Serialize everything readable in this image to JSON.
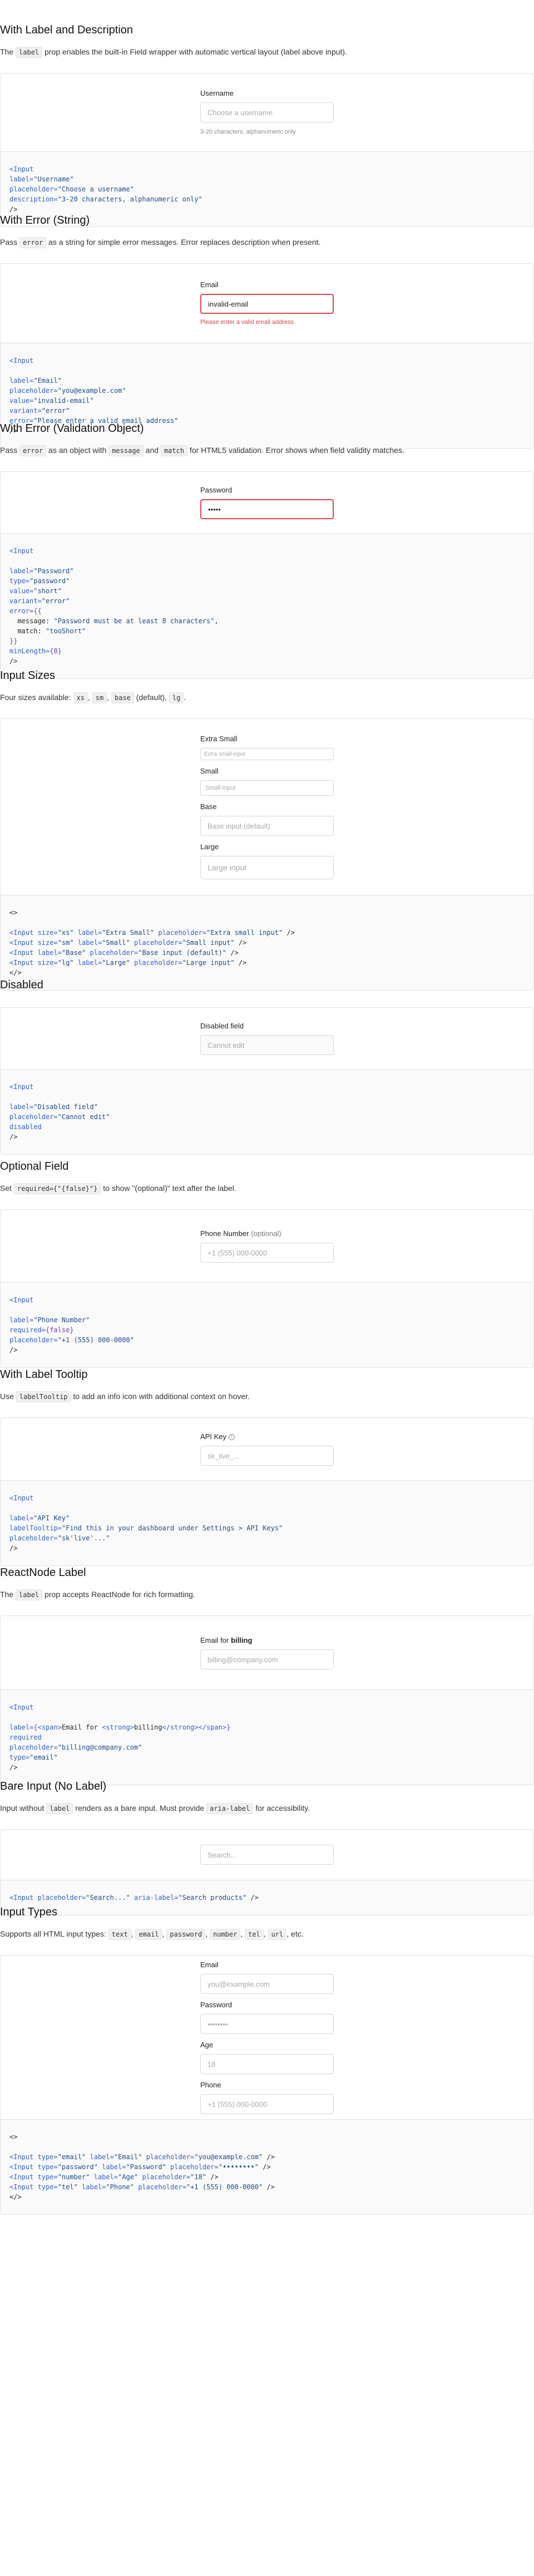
{
  "sections": [
    {
      "id": "label_desc",
      "title": "With Label and Description",
      "desc": [
        {
          "t": "The "
        },
        {
          "c": "label"
        },
        {
          "t": " prop enables the built-in Field wrapper with automatic vertical layout (label above input)."
        }
      ],
      "fields": [
        {
          "label": "Username",
          "placeholder": "Choose a username",
          "value": "",
          "hint": "3-20 characters, alphanumeric only"
        }
      ],
      "code": [
        [
          [
            "k",
            "<Input"
          ]
        ],
        [
          [
            "a",
            "label="
          ],
          [
            "s",
            "\"Username\""
          ]
        ],
        [
          [
            "a",
            "placeholder="
          ],
          [
            "s",
            "\"Choose a username\""
          ]
        ],
        [
          [
            "a",
            "description="
          ],
          [
            "s",
            "\"3-20 characters, alphanumeric only\""
          ]
        ],
        [
          [
            "p",
            "/>"
          ]
        ]
      ]
    },
    {
      "id": "error_string",
      "title": "With Error (String)",
      "desc": [
        {
          "t": "Pass "
        },
        {
          "c": "error"
        },
        {
          "t": " as a string for simple error messages. Error replaces description when present."
        }
      ],
      "fields": [
        {
          "label": "Email",
          "placeholder": "you@example.com",
          "value": "invalid-email",
          "error": "Please enter a valid email address"
        }
      ],
      "code": [
        [
          [
            "k",
            "<Input"
          ]
        ],
        [],
        [
          [
            "a",
            "label="
          ],
          [
            "s",
            "\"Email\""
          ]
        ],
        [
          [
            "a",
            "placeholder="
          ],
          [
            "s",
            "\"you@example.com\""
          ]
        ],
        [
          [
            "a",
            "value="
          ],
          [
            "s",
            "\"invalid-email\""
          ]
        ],
        [
          [
            "a",
            "variant="
          ],
          [
            "s",
            "\"error\""
          ]
        ],
        [
          [
            "a",
            "error="
          ],
          [
            "s",
            "\"Please enter a valid email address\""
          ]
        ],
        [
          [
            "p",
            "/>"
          ]
        ]
      ]
    },
    {
      "id": "error_object",
      "title": "With Error (Validation Object)",
      "desc": [
        {
          "t": "Pass "
        },
        {
          "c": "error"
        },
        {
          "t": " as an object with "
        },
        {
          "c": "message"
        },
        {
          "t": " and "
        },
        {
          "c": "match"
        },
        {
          "t": " for HTML5 validation. Error shows when field validity matches."
        }
      ],
      "fields": [
        {
          "label": "Password",
          "placeholder": "",
          "value": "short",
          "password": true,
          "errorBorder": true
        }
      ],
      "code": [
        [
          [
            "k",
            "<Input"
          ]
        ],
        [],
        [
          [
            "a",
            "label="
          ],
          [
            "s",
            "\"Password\""
          ]
        ],
        [
          [
            "a",
            "type="
          ],
          [
            "s",
            "\"password\""
          ]
        ],
        [
          [
            "a",
            "value="
          ],
          [
            "s",
            "\"short\""
          ]
        ],
        [
          [
            "a",
            "variant="
          ],
          [
            "s",
            "\"error\""
          ]
        ],
        [
          [
            "a",
            "error="
          ],
          [
            "e",
            "{{"
          ]
        ],
        [
          [
            "p",
            "  message: "
          ],
          [
            "s",
            "\"Password must be at least 8 characters\""
          ],
          [
            "p",
            ","
          ]
        ],
        [
          [
            "p",
            "  match: "
          ],
          [
            "s",
            "\"tooShort\""
          ]
        ],
        [
          [
            "e",
            "}}"
          ]
        ],
        [
          [
            "a",
            "minLength="
          ],
          [
            "e",
            "{8}"
          ]
        ],
        [
          [
            "p",
            "/>"
          ]
        ]
      ]
    },
    {
      "id": "sizes",
      "title": "Input Sizes",
      "desc": [
        {
          "t": "Four sizes available: "
        },
        {
          "c": "xs"
        },
        {
          "t": ", "
        },
        {
          "c": "sm"
        },
        {
          "t": ", "
        },
        {
          "c": "base"
        },
        {
          "t": " (default), "
        },
        {
          "c": "lg"
        },
        {
          "t": "."
        }
      ],
      "fields": [
        {
          "label": "Extra Small",
          "placeholder": "Extra small input",
          "value": "",
          "size": "xs"
        },
        {
          "label": "Small",
          "placeholder": "Small input",
          "value": "",
          "size": "sm"
        },
        {
          "label": "Base",
          "placeholder": "Base input (default)",
          "value": ""
        },
        {
          "label": "Large",
          "placeholder": "Large input",
          "value": "",
          "size": "lg"
        }
      ],
      "code": [
        [
          [
            "p",
            "<>"
          ]
        ],
        [],
        [
          [
            "k",
            "<Input "
          ],
          [
            "a",
            "size="
          ],
          [
            "s",
            "\"xs\" "
          ],
          [
            "a",
            "label="
          ],
          [
            "s",
            "\"Extra Small\" "
          ],
          [
            "a",
            "placeholder="
          ],
          [
            "s",
            "\"Extra small input\" "
          ],
          [
            "p",
            "/>"
          ]
        ],
        [
          [
            "k",
            "<Input "
          ],
          [
            "a",
            "size="
          ],
          [
            "s",
            "\"sm\" "
          ],
          [
            "a",
            "label="
          ],
          [
            "s",
            "\"Small\" "
          ],
          [
            "a",
            "placeholder="
          ],
          [
            "s",
            "\"Small input\" "
          ],
          [
            "p",
            "/>"
          ]
        ],
        [
          [
            "k",
            "<Input "
          ],
          [
            "a",
            "label="
          ],
          [
            "s",
            "\"Base\" "
          ],
          [
            "a",
            "placeholder="
          ],
          [
            "s",
            "\"Base input (default)\" "
          ],
          [
            "p",
            "/>"
          ]
        ],
        [
          [
            "k",
            "<Input "
          ],
          [
            "a",
            "size="
          ],
          [
            "s",
            "\"lg\" "
          ],
          [
            "a",
            "label="
          ],
          [
            "s",
            "\"Large\" "
          ],
          [
            "a",
            "placeholder="
          ],
          [
            "s",
            "\"Large input\" "
          ],
          [
            "p",
            "/>"
          ]
        ],
        [
          [
            "p",
            "</>"
          ]
        ]
      ]
    },
    {
      "id": "disabled",
      "title": "Disabled",
      "desc": [],
      "fields": [
        {
          "label": "Disabled field",
          "placeholder": "Cannot edit",
          "value": "",
          "disabled": true
        }
      ],
      "code": [
        [
          [
            "k",
            "<Input"
          ]
        ],
        [],
        [
          [
            "a",
            "label="
          ],
          [
            "s",
            "\"Disabled field\""
          ]
        ],
        [
          [
            "a",
            "placeholder="
          ],
          [
            "s",
            "\"Cannot edit\""
          ]
        ],
        [
          [
            "a",
            "disabled"
          ]
        ],
        [
          [
            "p",
            "/>"
          ]
        ]
      ]
    },
    {
      "id": "optional",
      "title": "Optional Field",
      "desc": [
        {
          "t": "Set "
        },
        {
          "c": "required={\"{false}\"}"
        },
        {
          "t": " to show \"(optional)\" text after the label."
        }
      ],
      "fields": [
        {
          "label": "Phone Number",
          "optional": "(optional)",
          "placeholder": "+1 (555) 000-0000",
          "value": ""
        }
      ],
      "code": [
        [
          [
            "k",
            "<Input"
          ]
        ],
        [],
        [
          [
            "a",
            "label="
          ],
          [
            "s",
            "\"Phone Number\""
          ]
        ],
        [
          [
            "a",
            "required="
          ],
          [
            "e",
            "{false}"
          ]
        ],
        [
          [
            "a",
            "placeholder="
          ],
          [
            "s",
            "\"+1 (555) 000-0000\""
          ]
        ],
        [
          [
            "p",
            "/>"
          ]
        ]
      ]
    },
    {
      "id": "tooltip",
      "title": "With Label Tooltip",
      "desc": [
        {
          "t": "Use "
        },
        {
          "c": "labelTooltip"
        },
        {
          "t": " to add an info icon with additional context on hover."
        }
      ],
      "fields": [
        {
          "label": "API Key",
          "tooltip": "i",
          "placeholder": "sk_live_...",
          "value": ""
        }
      ],
      "code": [
        [
          [
            "k",
            "<Input"
          ]
        ],
        [],
        [
          [
            "a",
            "label="
          ],
          [
            "s",
            "\"API Key\""
          ]
        ],
        [
          [
            "a",
            "labelTooltip="
          ],
          [
            "s",
            "\"Find this in your dashboard under Settings > API Keys\""
          ]
        ],
        [
          [
            "a",
            "placeholder="
          ],
          [
            "s",
            "\"sk'live'...\""
          ]
        ],
        [
          [
            "p",
            "/>"
          ]
        ]
      ]
    },
    {
      "id": "reactnode",
      "title": "ReactNode Label",
      "desc": [
        {
          "t": "The "
        },
        {
          "c": "label"
        },
        {
          "t": " prop accepts ReactNode for rich formatting."
        }
      ],
      "fields": [
        {
          "label": "Email for ",
          "labelBold": "billing",
          "placeholder": "billing@company.com",
          "value": ""
        }
      ],
      "code": [
        [
          [
            "k",
            "<Input"
          ]
        ],
        [],
        [
          [
            "a",
            "label="
          ],
          [
            "e",
            "{"
          ],
          [
            "k",
            "<span>"
          ],
          [
            "p",
            "Email for "
          ],
          [
            "k",
            "<strong>"
          ],
          [
            "p",
            "billing"
          ],
          [
            "k",
            "</strong></span>"
          ],
          [
            "e",
            "}"
          ]
        ],
        [
          [
            "a",
            "required"
          ]
        ],
        [
          [
            "a",
            "placeholder="
          ],
          [
            "s",
            "\"billing@company.com\""
          ]
        ],
        [
          [
            "a",
            "type="
          ],
          [
            "s",
            "\"email\""
          ]
        ],
        [
          [
            "p",
            "/>"
          ]
        ]
      ]
    },
    {
      "id": "bare",
      "title": "Bare Input (No Label)",
      "desc": [
        {
          "t": "Input without "
        },
        {
          "c": "label"
        },
        {
          "t": " renders as a bare input. Must provide "
        },
        {
          "c": "aria-label"
        },
        {
          "t": " for accessibility."
        }
      ],
      "fields": [
        {
          "label": "",
          "placeholder": "Search...",
          "value": ""
        }
      ],
      "code": [
        [
          [
            "k",
            "<Input "
          ],
          [
            "a",
            "placeholder="
          ],
          [
            "s",
            "\"Search...\" "
          ],
          [
            "a",
            "aria-label="
          ],
          [
            "s",
            "\"Search products\" "
          ],
          [
            "p",
            "/>"
          ]
        ]
      ]
    },
    {
      "id": "types",
      "title": "Input Types",
      "desc": [
        {
          "t": "Supports all HTML input types: "
        },
        {
          "c": "text"
        },
        {
          "t": ", "
        },
        {
          "c": "email"
        },
        {
          "t": ", "
        },
        {
          "c": "password"
        },
        {
          "t": ", "
        },
        {
          "c": "number"
        },
        {
          "t": ", "
        },
        {
          "c": "tel"
        },
        {
          "t": ", "
        },
        {
          "c": "url"
        },
        {
          "t": ", etc."
        }
      ],
      "fields": [
        {
          "label": "Email",
          "placeholder": "you@example.com",
          "value": ""
        },
        {
          "label": "Password",
          "placeholder": "••••••••",
          "value": ""
        },
        {
          "label": "Age",
          "placeholder": "18",
          "value": ""
        },
        {
          "label": "Phone",
          "placeholder": "+1 (555) 000-0000",
          "value": ""
        }
      ],
      "code": [
        [
          [
            "p",
            "<>"
          ]
        ],
        [],
        [
          [
            "k",
            "<Input "
          ],
          [
            "a",
            "type="
          ],
          [
            "s",
            "\"email\" "
          ],
          [
            "a",
            "label="
          ],
          [
            "s",
            "\"Email\" "
          ],
          [
            "a",
            "placeholder="
          ],
          [
            "s",
            "\"you@example.com\" "
          ],
          [
            "p",
            "/>"
          ]
        ],
        [
          [
            "k",
            "<Input "
          ],
          [
            "a",
            "type="
          ],
          [
            "s",
            "\"password\" "
          ],
          [
            "a",
            "label="
          ],
          [
            "s",
            "\"Password\" "
          ],
          [
            "a",
            "placeholder="
          ],
          [
            "s",
            "\"••••••••\" "
          ],
          [
            "p",
            "/>"
          ]
        ],
        [
          [
            "k",
            "<Input "
          ],
          [
            "a",
            "type="
          ],
          [
            "s",
            "\"number\" "
          ],
          [
            "a",
            "label="
          ],
          [
            "s",
            "\"Age\" "
          ],
          [
            "a",
            "placeholder="
          ],
          [
            "s",
            "\"18\" "
          ],
          [
            "p",
            "/>"
          ]
        ],
        [
          [
            "k",
            "<Input "
          ],
          [
            "a",
            "type="
          ],
          [
            "s",
            "\"tel\" "
          ],
          [
            "a",
            "label="
          ],
          [
            "s",
            "\"Phone\" "
          ],
          [
            "a",
            "placeholder="
          ],
          [
            "s",
            "\"+1 (555) 000-0000\" "
          ],
          [
            "p",
            "/>"
          ]
        ],
        [
          [
            "p",
            "</>"
          ]
        ]
      ]
    }
  ]
}
